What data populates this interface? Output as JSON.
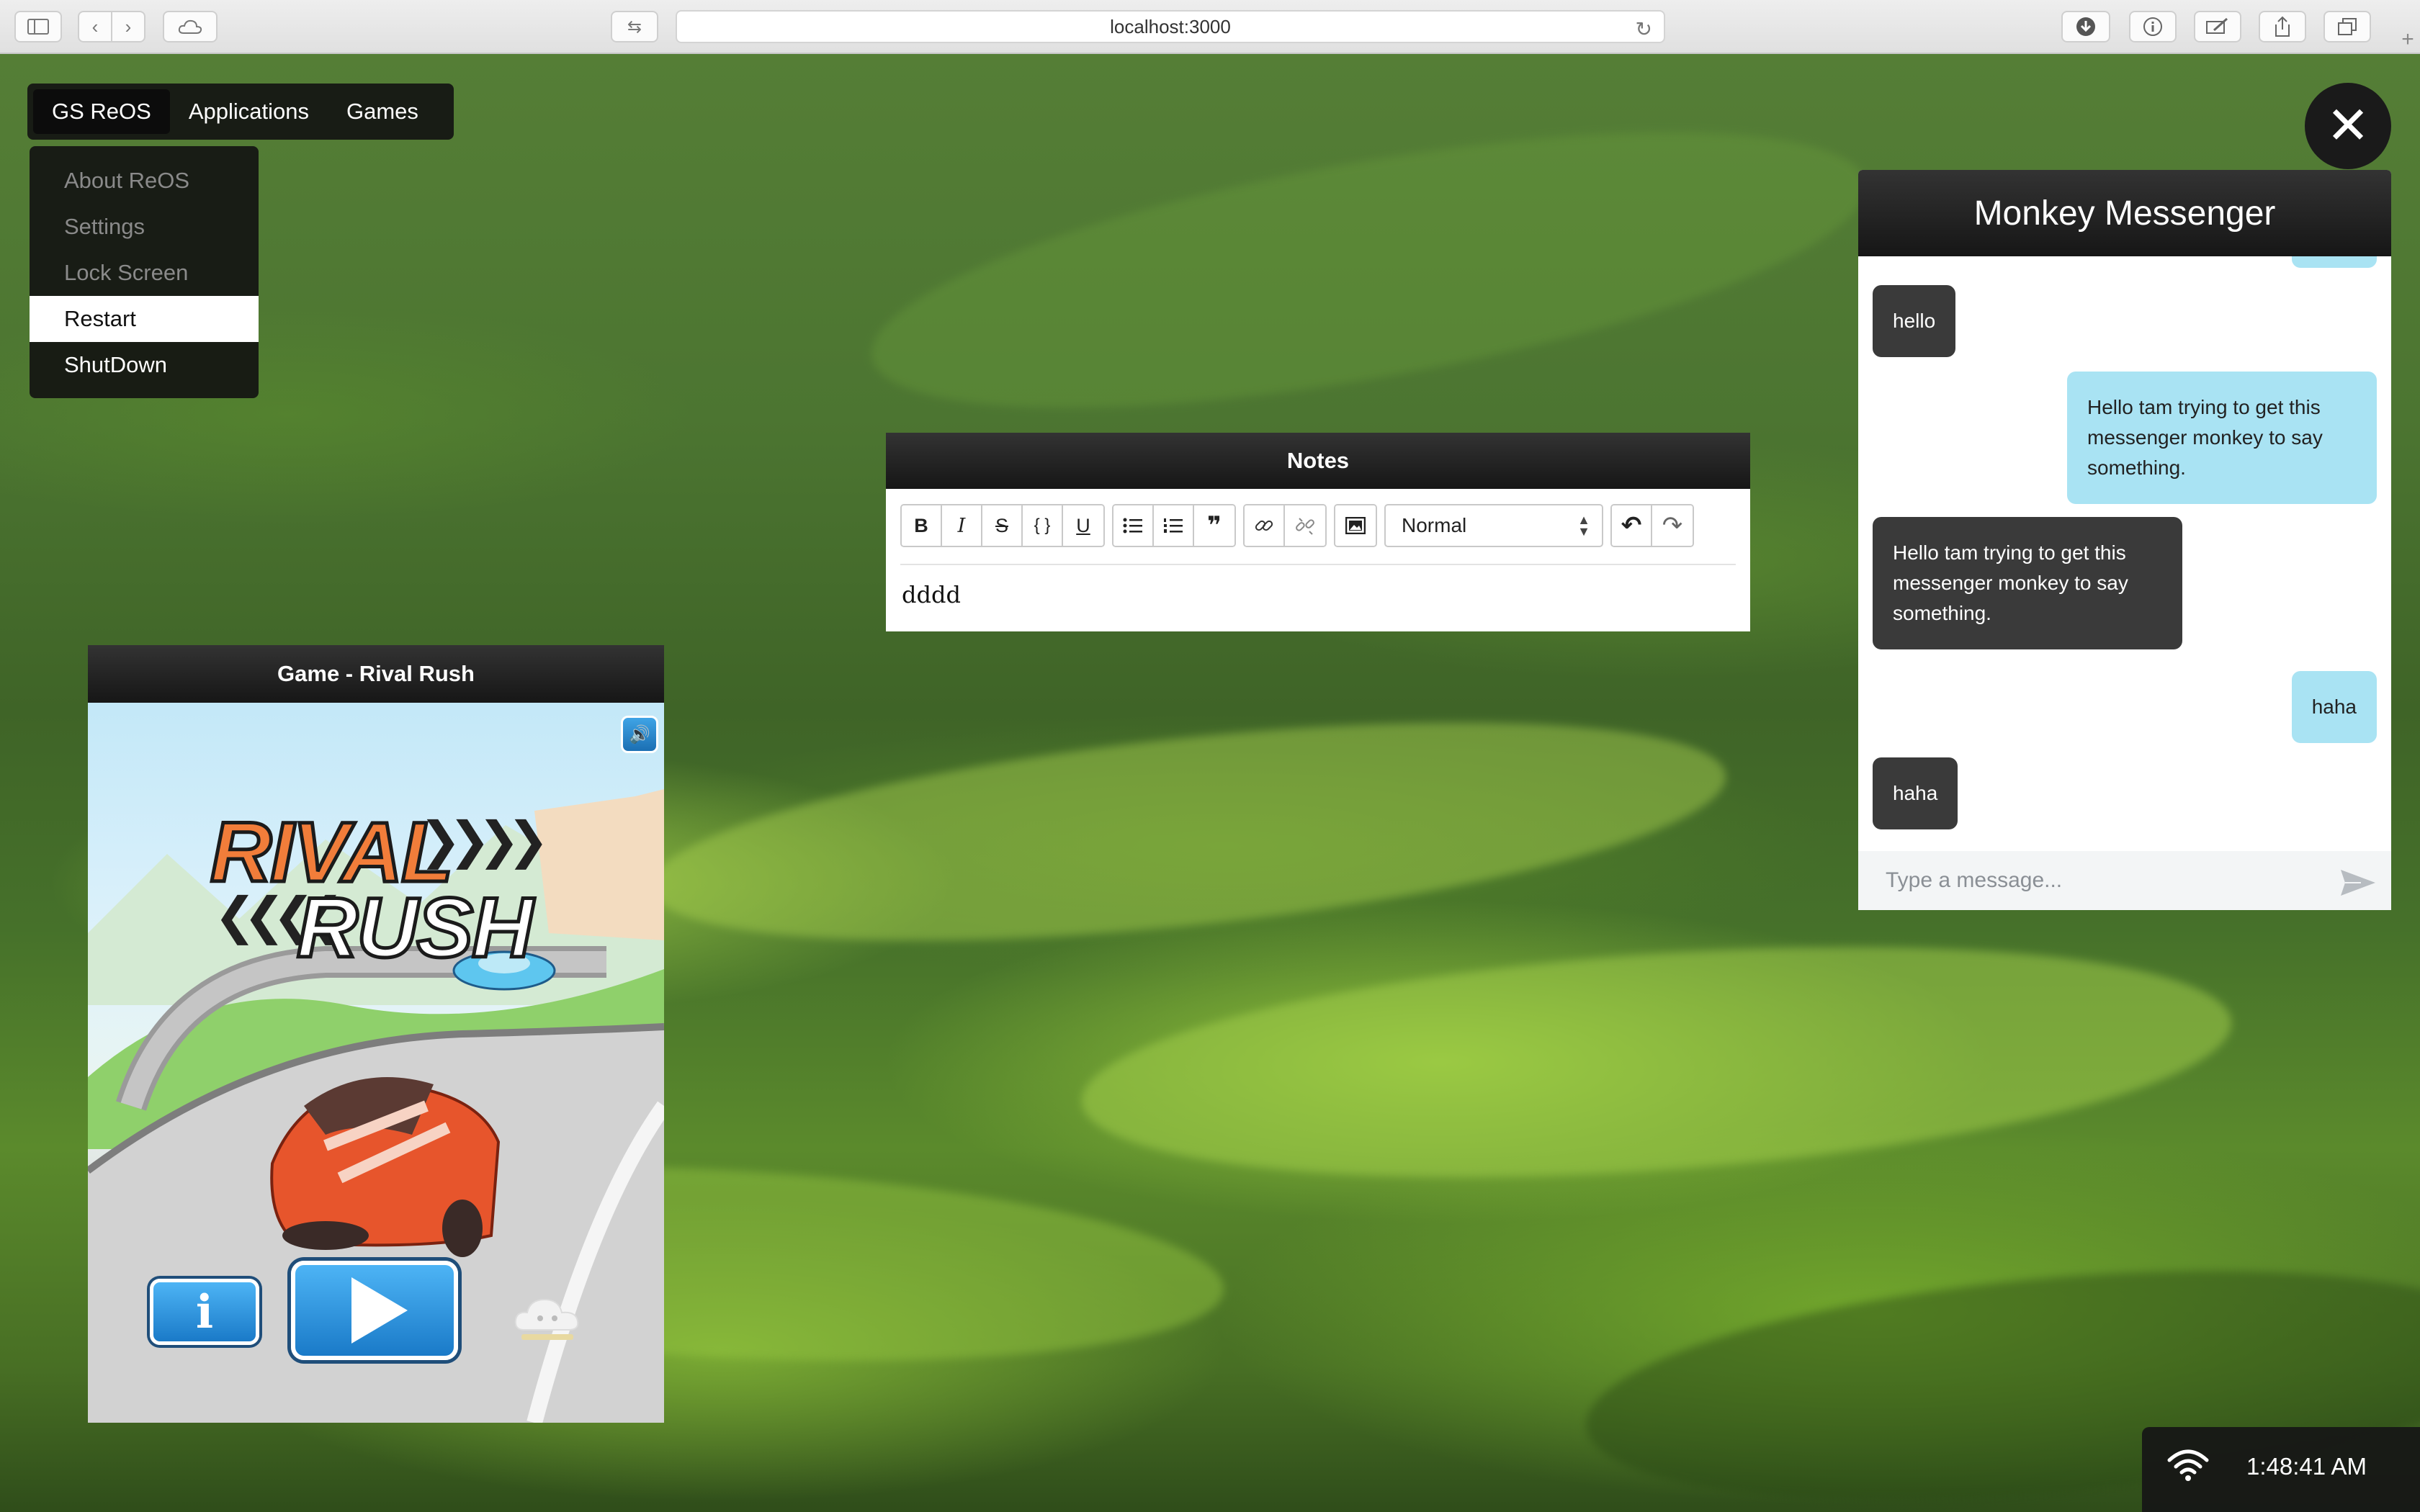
{
  "browser": {
    "url": "localhost:3000",
    "new_tab_symbol": "+"
  },
  "menubar": {
    "items": [
      {
        "label": "GS ReOS",
        "active": true
      },
      {
        "label": "Applications"
      },
      {
        "label": "Games"
      }
    ]
  },
  "dropdown": {
    "items": [
      {
        "label": "About ReOS",
        "state": "disabled"
      },
      {
        "label": "Settings",
        "state": "disabled"
      },
      {
        "label": "Lock Screen",
        "state": "disabled"
      },
      {
        "label": "Restart",
        "state": "hover"
      },
      {
        "label": "ShutDown",
        "state": "normal"
      }
    ]
  },
  "game_window": {
    "title": "Game - Rival Rush",
    "logo_line1": "RIVAL",
    "logo_line2": "RUSH",
    "info_symbol": "i",
    "sound_symbol": "🔊",
    "chevrons": "❯❯❯❯",
    "chevrons_left": "❮❮❮❮"
  },
  "notes_window": {
    "title": "Notes",
    "toolbar": {
      "bold": "B",
      "italic": "I",
      "strike": "S",
      "code": "{ }",
      "underline": "U",
      "bullet_list": "☰",
      "ordered_list": "≡",
      "quote": "❞",
      "link": "🔗",
      "unlink": "⛓",
      "image": "▣",
      "format_select": "Normal",
      "undo": "↶",
      "redo": "↷"
    },
    "content": "dddd"
  },
  "close_button": {
    "symbol": "✕"
  },
  "messenger": {
    "title": "Monkey Messenger",
    "messages": [
      {
        "dir": "in",
        "text": "hello"
      },
      {
        "dir": "out",
        "text": "Hello tam trying to get this messenger monkey to say something."
      },
      {
        "dir": "in",
        "text": "Hello tam trying to get this messenger monkey to say something."
      },
      {
        "dir": "out",
        "text": "haha"
      },
      {
        "dir": "in",
        "text": "haha"
      }
    ],
    "input_placeholder": "Type a message..."
  },
  "tray": {
    "time": "1:48:41 AM"
  },
  "colors": {
    "window_title_bg": "#1a1a1a",
    "incoming_bubble": "#3a3a3a",
    "outgoing_bubble": "#a9e3f3",
    "wallpaper_green": "#4c7531"
  }
}
